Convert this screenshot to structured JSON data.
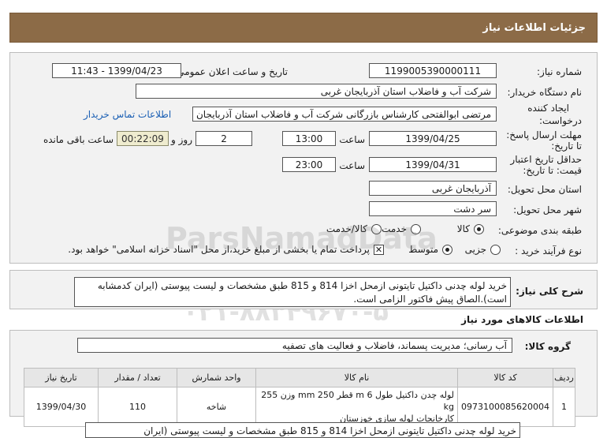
{
  "header": {
    "title": "جزئیات اطلاعات نیاز"
  },
  "form": {
    "need_number_label": "شماره نیاز:",
    "need_number": "1199005390000111",
    "announce_label": "تاریخ و ساعت اعلان عمومی:",
    "announce_value": "1399/04/23 - 11:43",
    "buyer_label": "نام دستگاه خریدار:",
    "buyer_value": "شرکت آب و فاضلاب استان آذربایجان غربی",
    "creator_label_1": "ایجاد کننده",
    "creator_label_2": "درخواست:",
    "creator_value": "مرتضی ابوالفتحی کارشناس بازرگانی شرکت آب و فاضلاب استان آذربایجان غربی",
    "contact_link": "اطلاعات تماس خریدار",
    "deadline_label_1": "مهلت ارسال پاسخ:",
    "deadline_label_2": "تا تاریخ:",
    "deadline_date": "1399/04/25",
    "time_label": "ساعت",
    "deadline_time": "13:00",
    "days_value": "2",
    "days_label": "روز و",
    "remaining_time": "00:22:09",
    "remaining_label": "ساعت باقی مانده",
    "validity_label_1": "حداقل تاریخ اعتبار",
    "validity_label_2": "قیمت: تا تاریخ:",
    "validity_date": "1399/04/31",
    "validity_time": "23:00",
    "province_label": "استان محل تحویل:",
    "province_value": "آذربایجان غربی",
    "city_label": "شهر محل تحویل:",
    "city_value": "سر دشت",
    "category_label": "طبقه بندی موضوعی:",
    "category_options": [
      "کالا",
      "خدمت",
      "کالا/خدمت"
    ],
    "process_label": "نوع فرآیند خرید :",
    "process_options": [
      "جزیی",
      "متوسط"
    ],
    "payment_note": "پرداخت تمام یا بخشی از مبلغ خرید،از محل \"اسناد خزانه اسلامی\" خواهد بود."
  },
  "description": {
    "label": "شرح کلی نیاز:",
    "text": "خرید لوله چدنی داکتیل تایتونی ازمحل اخزا 814 و 815  طبق مشخصات و لیست پیوستی (ایران کدمشابه است).الصاق پیش فاکتور الزامی است.",
    "text_bottom": "خرید لوله چدنی داکتیل تایتونی ازمحل اخزا 814 و 815  طبق مشخصات و لیست پیوستی (ایران"
  },
  "goods_info": {
    "section_title": "اطلاعات کالاهای مورد نیاز",
    "group_label": "گروه کالا:",
    "group_value": "آب رسانی؛ مدیریت پسماند، فاضلاب و فعالیت های تصفیه"
  },
  "table": {
    "headers": [
      "ردیف",
      "کد کالا",
      "نام کالا",
      "واحد شمارش",
      "تعداد / مقدار",
      "تاریخ نیاز"
    ],
    "rows": [
      {
        "index": "1",
        "code": "0973100085620004",
        "name_line1": "لوله چدن داکتیل طول 6 m قطر 250 mm وزن 255 kg",
        "name_line2": "کارخانجات لوله سازی خوزستان",
        "unit": "شاخه",
        "qty": "110",
        "date": "1399/04/30"
      }
    ]
  },
  "watermark": {
    "brand": "ParsNamadData",
    "line1": "پایگاه اطلاع رسانی مناقصه و مزایده",
    "phone": "۰۲۱-۸۸۳۴۹۶۷۰-۵"
  }
}
